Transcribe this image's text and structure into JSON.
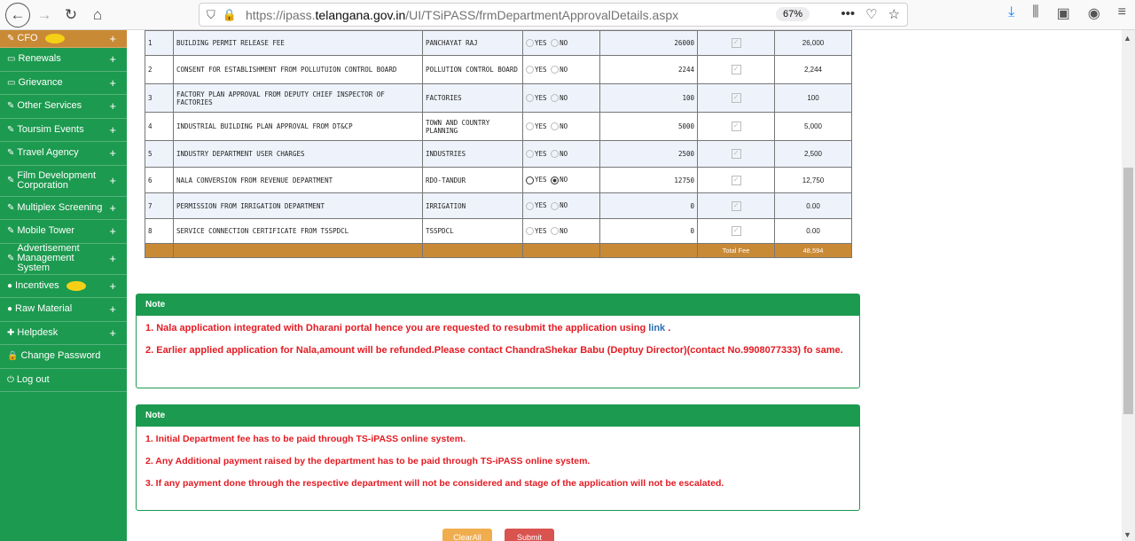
{
  "browser": {
    "url_prefix": "https://ipass.",
    "url_domain": "telangana.gov.in",
    "url_path": "/UI/TSiPASS/frmDepartmentApprovalDetails.aspx",
    "zoom": "67%"
  },
  "sidebar": {
    "top_item": "CFO",
    "items": [
      {
        "label": "Renewals",
        "icon": "monitor-icon"
      },
      {
        "label": "Grievance",
        "icon": "monitor-icon"
      },
      {
        "label": "Other Services",
        "icon": "edit-icon"
      },
      {
        "label": "Toursim Events",
        "icon": "edit-icon"
      },
      {
        "label": "Travel Agency",
        "icon": "edit-icon"
      },
      {
        "label": "Film Development Corporation",
        "icon": "edit-icon"
      },
      {
        "label": "Multiplex Screening",
        "icon": "edit-icon"
      },
      {
        "label": "Mobile Tower",
        "icon": "edit-icon"
      },
      {
        "label": "Advertisement Management System",
        "icon": "edit-icon"
      },
      {
        "label": "Incentives",
        "icon": "users-icon"
      },
      {
        "label": "Raw Material",
        "icon": "users-icon"
      },
      {
        "label": "Helpdesk",
        "icon": "wrench-icon"
      },
      {
        "label": "Change Password",
        "icon": "lock-icon"
      },
      {
        "label": "Log out",
        "icon": "power-icon"
      }
    ]
  },
  "table": {
    "rows": [
      {
        "no": "1",
        "name": "BUILDING PERMIT RELEASE FEE",
        "dept": "PANCHAYAT RAJ",
        "amount": "26000",
        "total": "26,000"
      },
      {
        "no": "2",
        "name": "CONSENT FOR ESTABLISHMENT FROM POLLUTUION CONTROL BOARD",
        "dept": "POLLUTION CONTROL BOARD",
        "amount": "2244",
        "total": "2,244"
      },
      {
        "no": "3",
        "name": "FACTORY PLAN APPROVAL FROM DEPUTY CHIEF INSPECTOR OF FACTORIES",
        "dept": "FACTORIES",
        "amount": "100",
        "total": "100"
      },
      {
        "no": "4",
        "name": "INDUSTRIAL BUILDING PLAN APPROVAL FROM DT&CP",
        "dept": "TOWN AND COUNTRY PLANNING",
        "amount": "5000",
        "total": "5,000"
      },
      {
        "no": "5",
        "name": "INDUSTRY DEPARTMENT USER CHARGES",
        "dept": "INDUSTRIES",
        "amount": "2500",
        "total": "2,500"
      },
      {
        "no": "6",
        "name": "NALA CONVERSION FROM REVENUE DEPARTMENT",
        "dept": "RDO-TANDUR",
        "amount": "12750",
        "total": "12,750"
      },
      {
        "no": "7",
        "name": "PERMISSION FROM IRRIGATION DEPARTMENT",
        "dept": "IRRIGATION",
        "amount": "0",
        "total": "0.00"
      },
      {
        "no": "8",
        "name": "SERVICE CONNECTION CERTIFICATE FROM TSSPDCL",
        "dept": "TSSPDCL",
        "amount": "0",
        "total": "0.00"
      }
    ],
    "yes_label": "YES",
    "no_label": "NO",
    "total_fee_label": "Total Fee",
    "total_fee_value": "48,594"
  },
  "note1": {
    "title": "Note",
    "line1_pre": "1. Nala application integrated with Dharani portal hence you are requested to resubmit the application using ",
    "line1_link": "link",
    "line1_post": " .",
    "line2": "2. Earlier applied application for Nala,amount will be refunded.Please contact ChandraShekar Babu (Deptuy Director)(contact No.9908077333) fo same."
  },
  "note2": {
    "title": "Note",
    "line1": "1. Initial Department fee has to be paid through TS-iPASS online system.",
    "line2": "2. Any Additional payment raised by the department has to be paid through TS-iPASS online system.",
    "line3": "3. If any payment done through the respective department will not be considered and stage of the application will not be escalated."
  },
  "buttons": {
    "clear": "ClearAll",
    "submit": "Submit"
  }
}
